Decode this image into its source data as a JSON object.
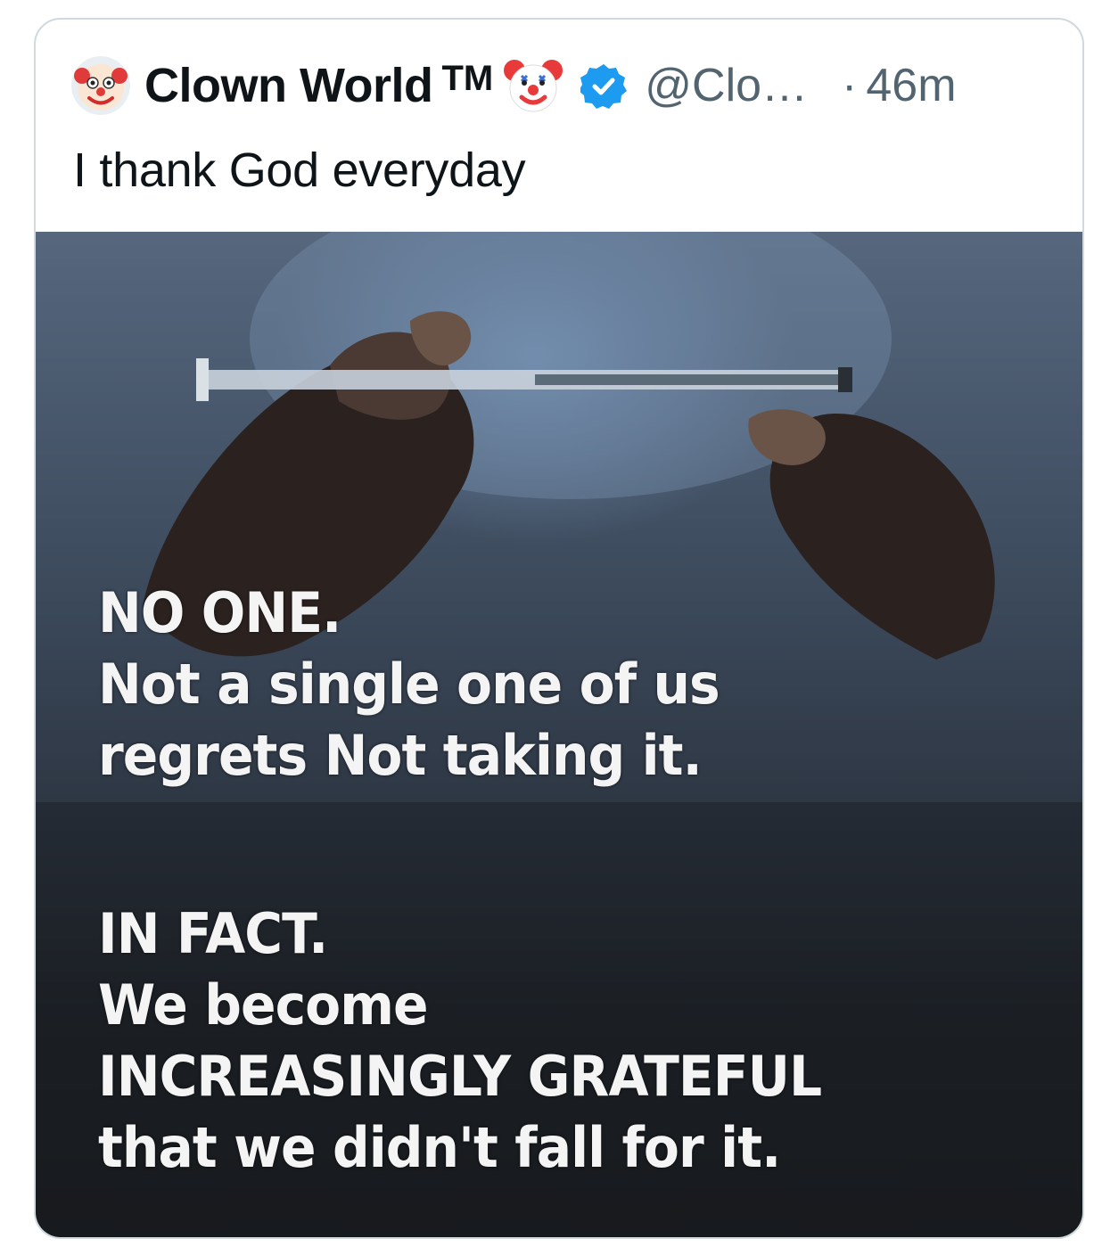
{
  "tweet": {
    "author_name": "Clown World",
    "trademark": "TM",
    "handle": "@Clo…",
    "separator": "·",
    "time": "46m",
    "text": "I thank God everyday",
    "verified_color": "#1d9bf0",
    "avatar_icon": "clown-face-icon",
    "name_emoji_icon": "clown-face-icon"
  },
  "image": {
    "caption_block_1": [
      "NO ONE.",
      "Not a single one of us",
      "regrets Not taking it."
    ],
    "caption_block_2": [
      "IN FACT.",
      "We become",
      "INCREASINGLY GRATEFUL",
      "that we didn't fall for it."
    ]
  }
}
